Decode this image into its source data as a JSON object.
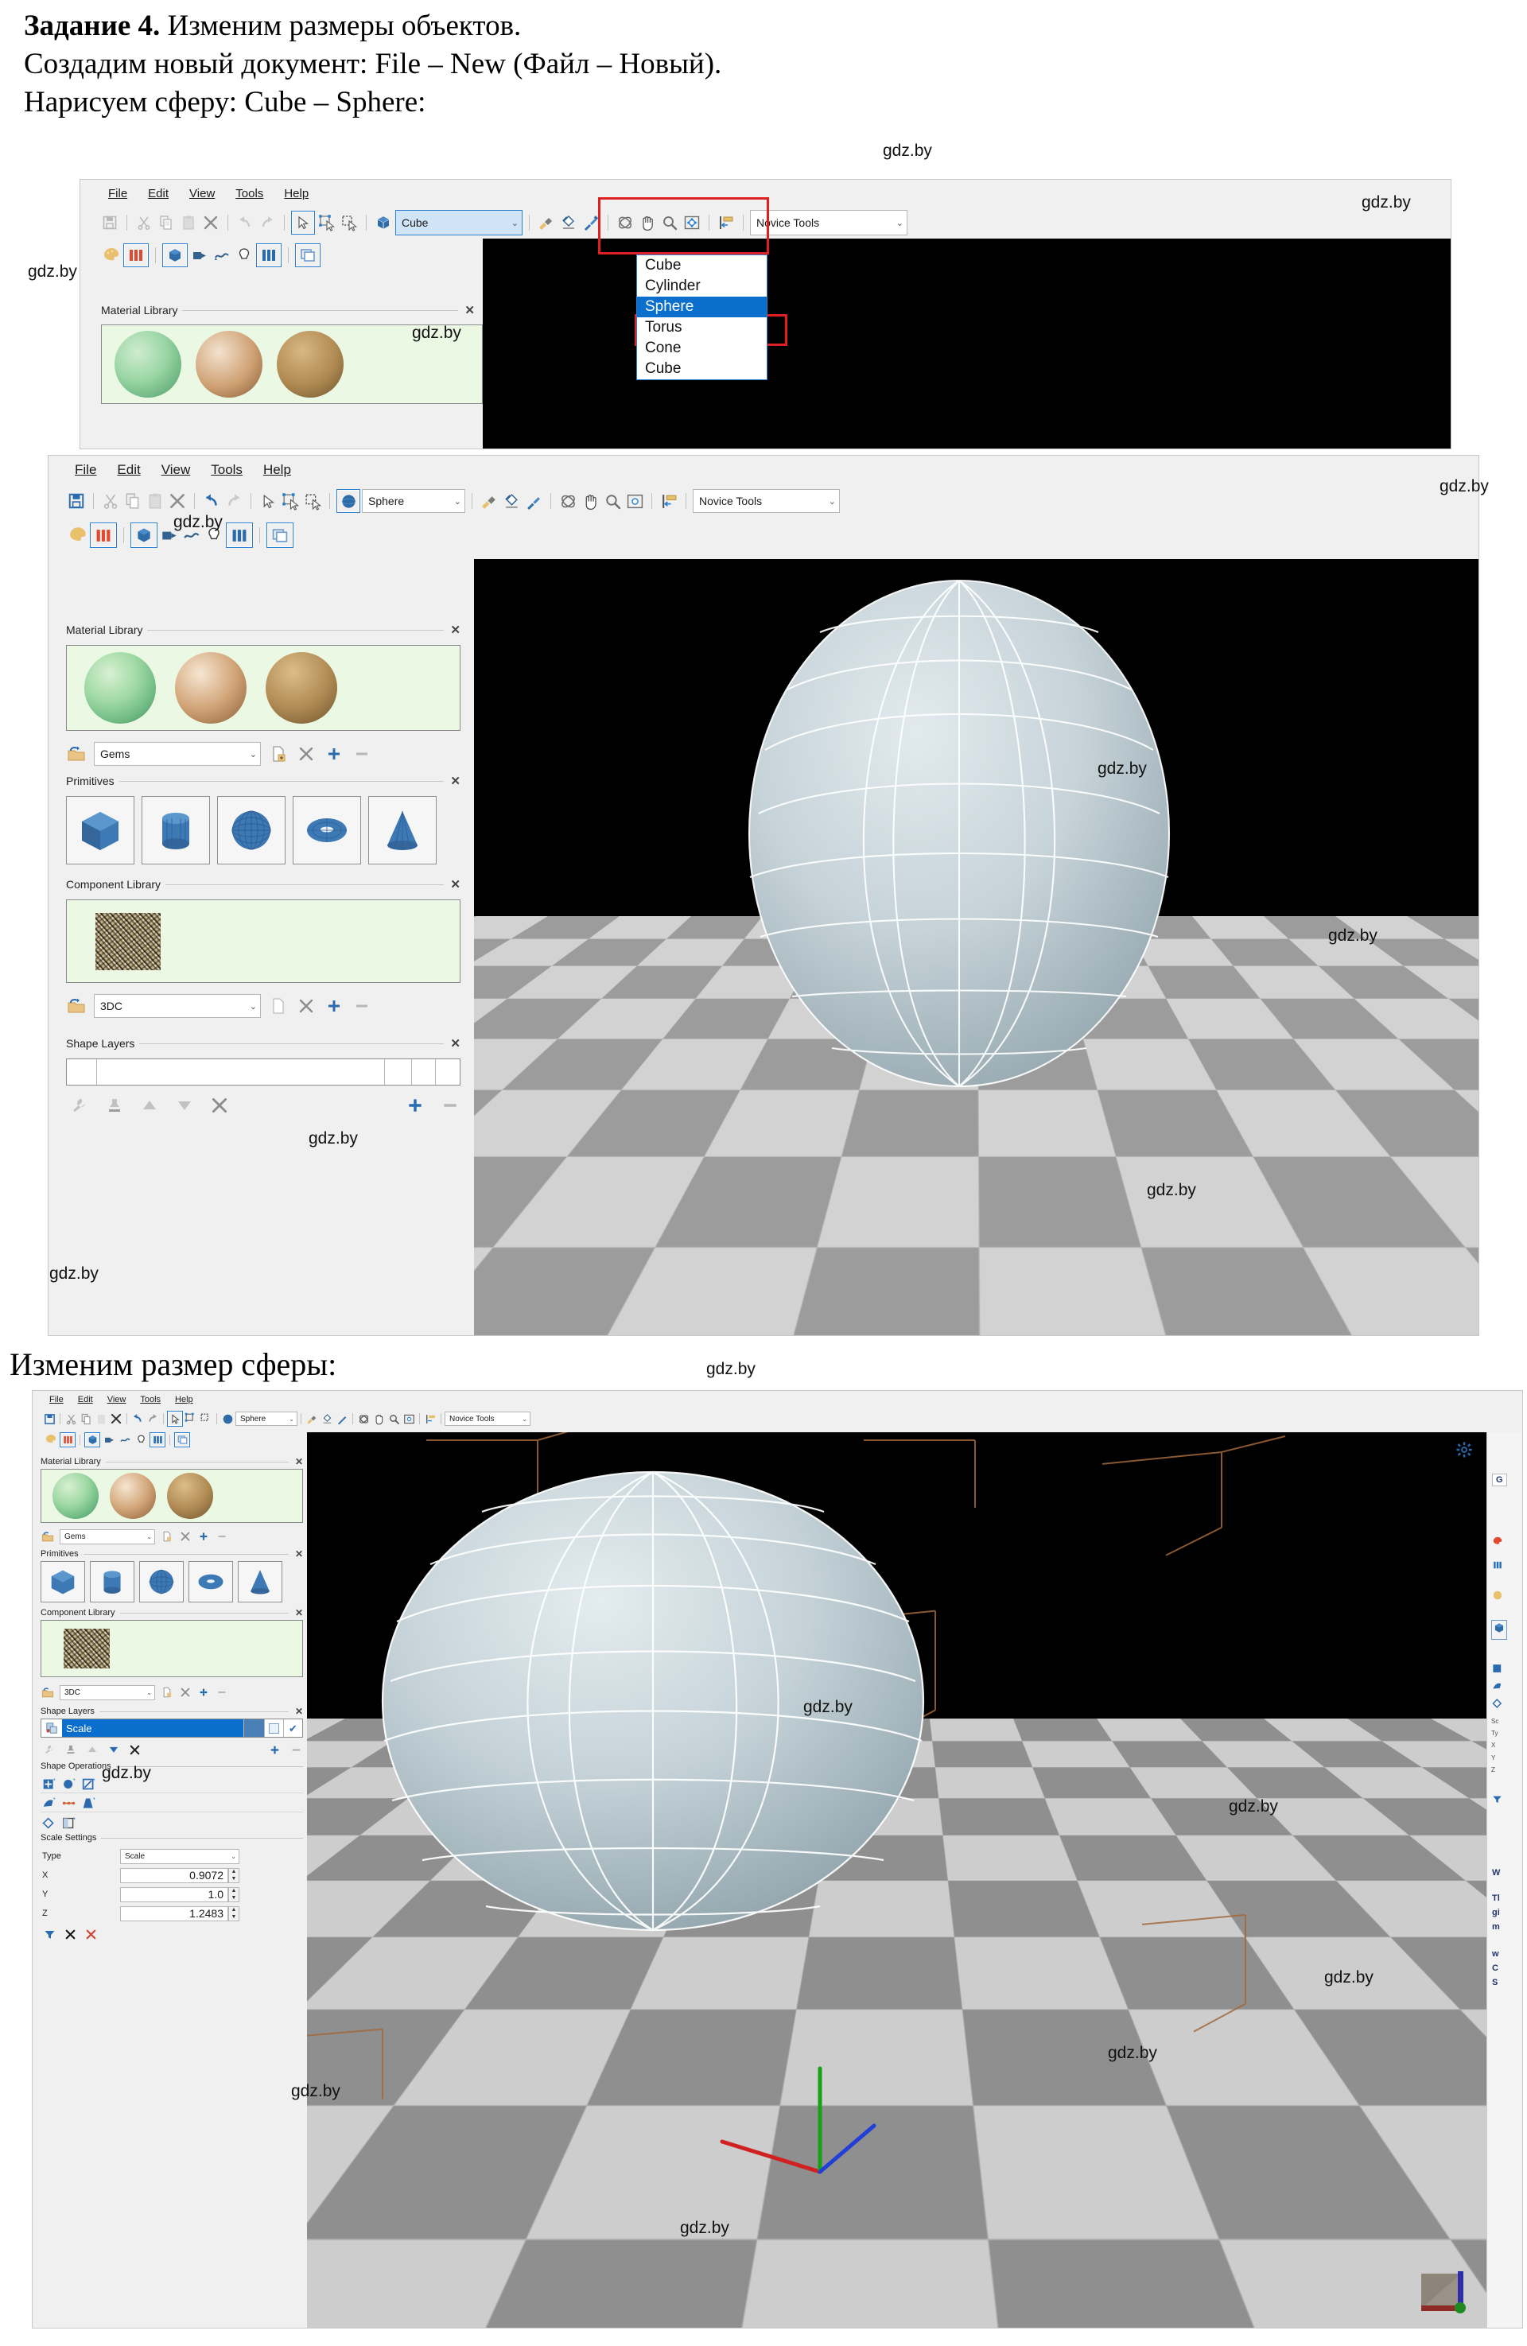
{
  "document": {
    "line1_bold": "Задание 4.",
    "line1_rest": " Изменим размеры объектов.",
    "line2": "Создадим новый документ: File – New (Файл – Новый).",
    "line3": "Нарисуем сферу: Cube – Sphere:",
    "line4": "Изменим размер сферы:"
  },
  "watermark": {
    "text": "gdz.by"
  },
  "menu": {
    "file": "File",
    "edit": "Edit",
    "view": "View",
    "tools": "Tools",
    "help": "Help"
  },
  "window1": {
    "primitive_combo_value": "Cube",
    "toolset_combo_value": "Novice Tools",
    "dropdown_options": [
      "Cube",
      "Cylinder",
      "Sphere",
      "Torus",
      "Cone",
      "Cube"
    ],
    "dropdown_selected": "Sphere",
    "panels": {
      "material_library": "Material Library"
    }
  },
  "window2": {
    "primitive_combo_value": "Sphere",
    "toolset_combo_value": "Novice Tools",
    "panels": {
      "material_library": "Material Library",
      "primitives": "Primitives",
      "component_library": "Component Library",
      "shape_layers": "Shape Layers"
    },
    "material_set_combo": "Gems",
    "component_set_combo": "3DC"
  },
  "window3": {
    "primitive_combo_value": "Sphere",
    "toolset_combo_value": "Novice Tools",
    "panels": {
      "material_library": "Material Library",
      "primitives": "Primitives",
      "component_library": "Component Library",
      "shape_layers": "Shape Layers",
      "shape_operations": "Shape Operations",
      "scale_settings": "Scale Settings"
    },
    "material_set_combo": "Gems",
    "component_set_combo": "3DC",
    "shape_layer_item": "Scale",
    "scale_settings": {
      "type_label": "Type",
      "type_value": "Scale",
      "x_label": "X",
      "x_value": "0.9072",
      "y_label": "Y",
      "y_value": "1.0",
      "z_label": "Z",
      "z_value": "1.2483"
    },
    "dock_fragments": [
      "G",
      "W",
      "Tl",
      "gi",
      "m",
      "w",
      "C",
      "S"
    ]
  },
  "colors": {
    "accent_blue": "#2a7fd4",
    "select_blue": "#0a6ecd",
    "highlight_red": "#e02020",
    "panel_bg": "#f0f0f0",
    "swatch_bg": "#eaf8e4",
    "prim_blue": "#3d79b5"
  }
}
